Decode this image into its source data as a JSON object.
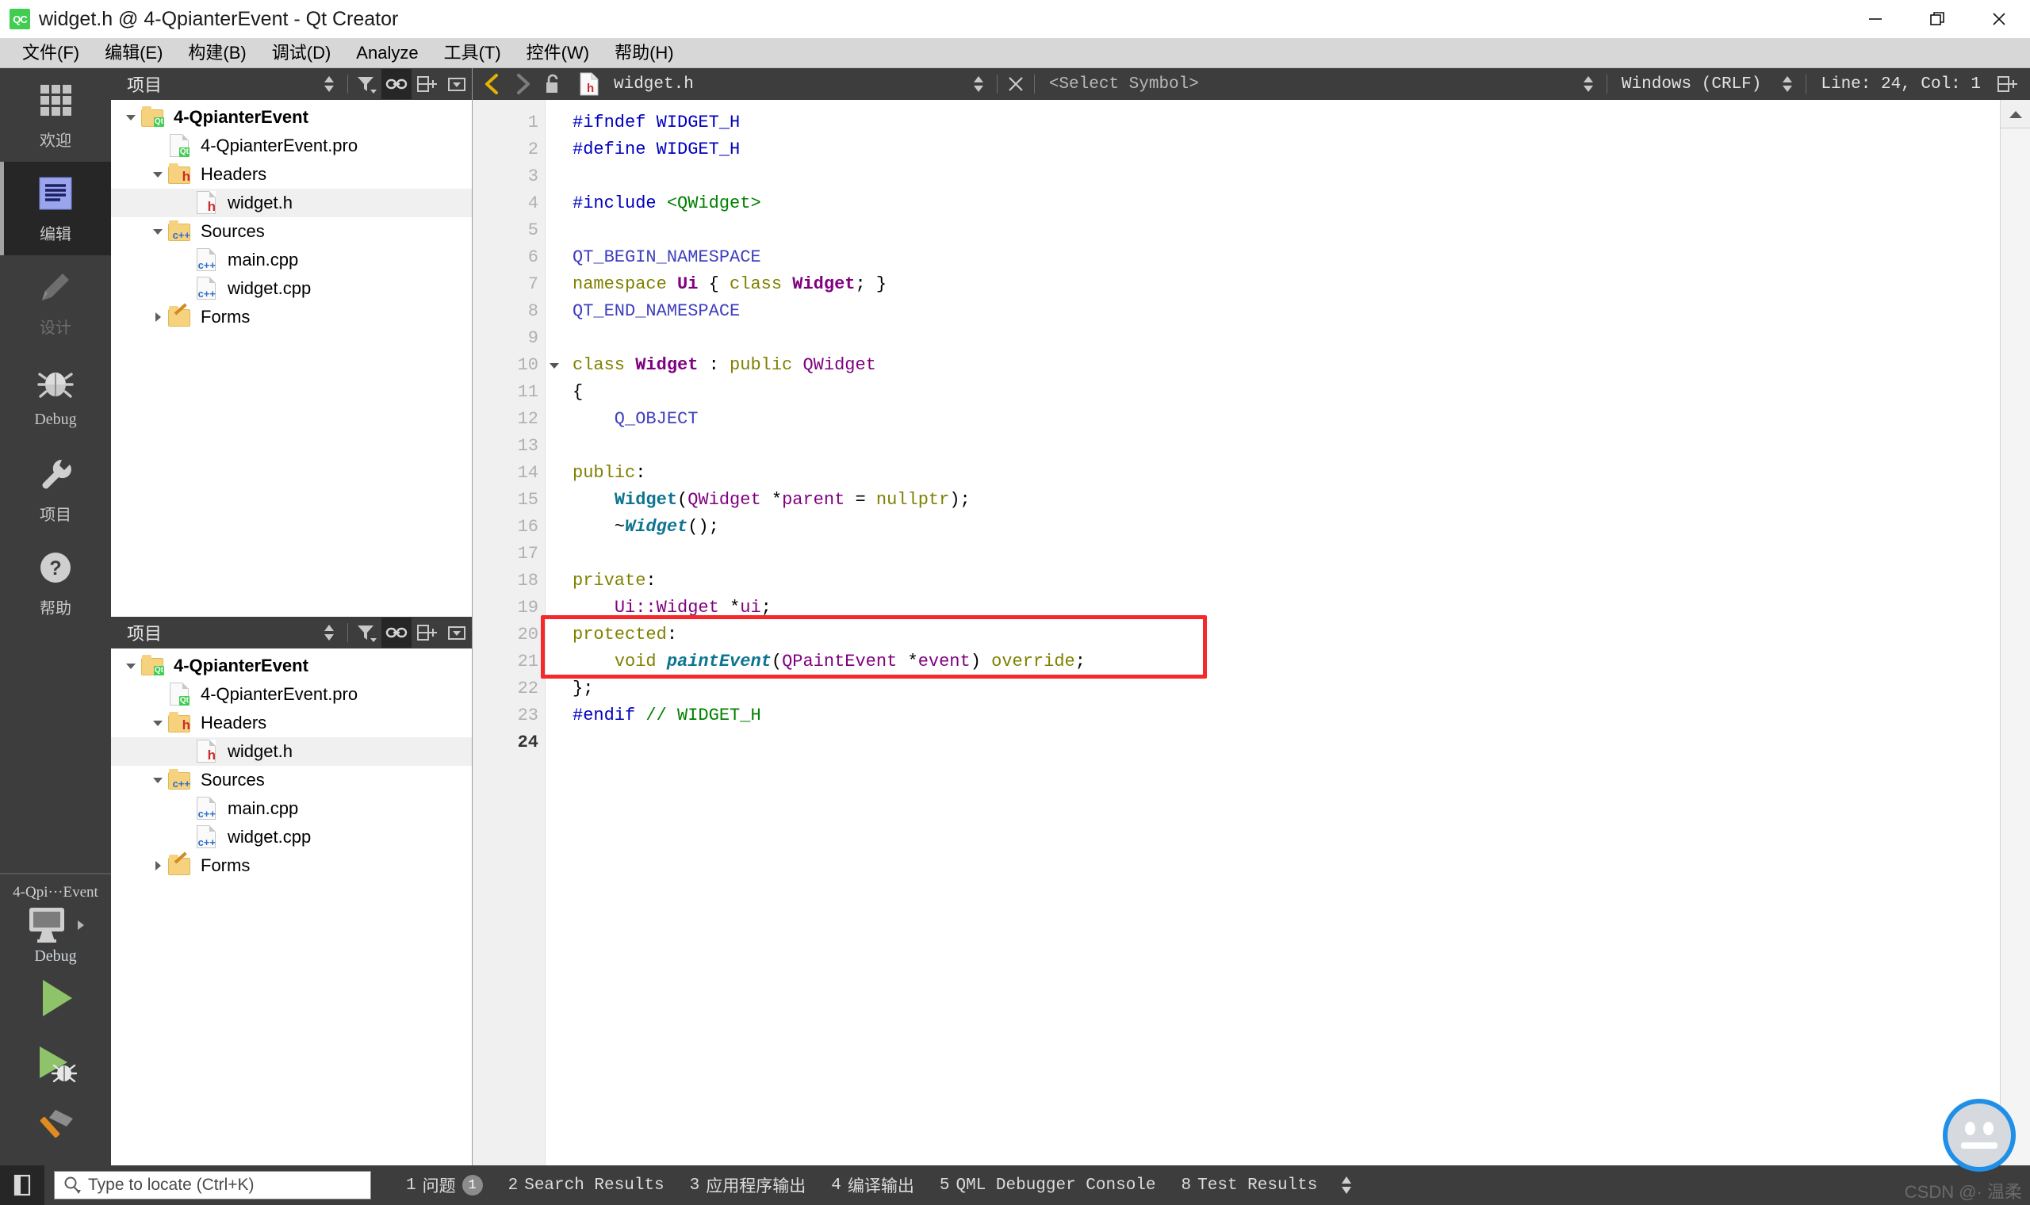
{
  "window": {
    "title": "widget.h @ 4-QpianterEvent - Qt Creator",
    "logo_text": "QC",
    "minimize": "—",
    "maximize": "❐",
    "close": "✕"
  },
  "menubar": {
    "items": [
      {
        "label": "文件(F)",
        "mnemonic": "F"
      },
      {
        "label": "编辑(E)",
        "mnemonic": "E"
      },
      {
        "label": "构建(B)",
        "mnemonic": "B"
      },
      {
        "label": "调试(D)",
        "mnemonic": "D"
      },
      {
        "label": "Analyze",
        "mnemonic": "A"
      },
      {
        "label": "工具(T)",
        "mnemonic": "T"
      },
      {
        "label": "控件(W)",
        "mnemonic": "W"
      },
      {
        "label": "帮助(H)",
        "mnemonic": "H"
      }
    ]
  },
  "activity_bar": {
    "modes": [
      {
        "label": "欢迎",
        "icon": "grid-icon",
        "active": false,
        "dim": false
      },
      {
        "label": "编辑",
        "icon": "edit-lines-icon",
        "active": true,
        "dim": false
      },
      {
        "label": "设计",
        "icon": "pencil-icon",
        "active": false,
        "dim": true
      },
      {
        "label": "Debug",
        "icon": "bug-icon",
        "active": false,
        "dim": false
      },
      {
        "label": "项目",
        "icon": "wrench-icon",
        "active": false,
        "dim": false
      },
      {
        "label": "帮助",
        "icon": "question-circle-icon",
        "active": false,
        "dim": false
      }
    ],
    "kit": {
      "project_name": "4-Qpi···Event",
      "build_config": "Debug",
      "target_icon": "desktop-icon",
      "run_label": "run-button",
      "debug_label": "run-debug-button",
      "build_label": "build-hammer-button"
    }
  },
  "project_panel_top": {
    "title": "项目",
    "tools": [
      "sort-icon",
      "filter-icon",
      "link-icon",
      "split-add-icon",
      "close-split-icon"
    ],
    "link_active": true,
    "tree": [
      {
        "label": "4-QpianterEvent",
        "icon": "qt-folder-icon",
        "indent": 0,
        "twisty": "down",
        "bold": true,
        "selected": false
      },
      {
        "label": "4-QpianterEvent.pro",
        "icon": "qt-file-icon",
        "indent": 1,
        "twisty": "none",
        "bold": false,
        "selected": false
      },
      {
        "label": "Headers",
        "icon": "h-folder-icon",
        "indent": 1,
        "twisty": "down",
        "bold": false,
        "selected": false
      },
      {
        "label": "widget.h",
        "icon": "h-file-icon",
        "indent": 2,
        "twisty": "none",
        "bold": false,
        "selected": true
      },
      {
        "label": "Sources",
        "icon": "cpp-folder-icon",
        "indent": 1,
        "twisty": "down",
        "bold": false,
        "selected": false
      },
      {
        "label": "main.cpp",
        "icon": "cpp-file-icon",
        "indent": 2,
        "twisty": "none",
        "bold": false,
        "selected": false
      },
      {
        "label": "widget.cpp",
        "icon": "cpp-file-icon",
        "indent": 2,
        "twisty": "none",
        "bold": false,
        "selected": false
      },
      {
        "label": "Forms",
        "icon": "forms-folder-icon",
        "indent": 1,
        "twisty": "right",
        "bold": false,
        "selected": false
      }
    ]
  },
  "project_panel_bottom": {
    "title": "项目",
    "tools": [
      "sort-icon",
      "filter-icon",
      "link-icon",
      "split-add-icon",
      "close-split-icon"
    ],
    "link_active": true,
    "tree": [
      {
        "label": "4-QpianterEvent",
        "icon": "qt-folder-icon",
        "indent": 0,
        "twisty": "down",
        "bold": true,
        "selected": false
      },
      {
        "label": "4-QpianterEvent.pro",
        "icon": "qt-file-icon",
        "indent": 1,
        "twisty": "none",
        "bold": false,
        "selected": false
      },
      {
        "label": "Headers",
        "icon": "h-folder-icon",
        "indent": 1,
        "twisty": "down",
        "bold": false,
        "selected": false
      },
      {
        "label": "widget.h",
        "icon": "h-file-icon",
        "indent": 2,
        "twisty": "none",
        "bold": false,
        "selected": true
      },
      {
        "label": "Sources",
        "icon": "cpp-folder-icon",
        "indent": 1,
        "twisty": "down",
        "bold": false,
        "selected": false
      },
      {
        "label": "main.cpp",
        "icon": "cpp-file-icon",
        "indent": 2,
        "twisty": "none",
        "bold": false,
        "selected": false
      },
      {
        "label": "widget.cpp",
        "icon": "cpp-file-icon",
        "indent": 2,
        "twisty": "none",
        "bold": false,
        "selected": false
      },
      {
        "label": "Forms",
        "icon": "forms-folder-icon",
        "indent": 1,
        "twisty": "right",
        "bold": false,
        "selected": false
      }
    ]
  },
  "editor_toolbar": {
    "back_icon": "chevron-left-icon",
    "forward_icon": "chevron-right-icon",
    "lock_icon": "unlocked-icon",
    "file_icon": "h-file-icon",
    "file_name": "widget.h",
    "close_icon": "close-icon",
    "symbol_selector": "<Select Symbol>",
    "line_ending": "Windows (CRLF)",
    "cursor_position": "Line: 24, Col: 1",
    "split_icon": "split-add-icon"
  },
  "editor": {
    "gutter_current_line": 24,
    "total_lines": 24,
    "fold_marker_line": 10,
    "lines": [
      {
        "n": 1,
        "tokens": [
          {
            "t": "#ifndef WIDGET_H",
            "c": "k-pre"
          }
        ]
      },
      {
        "n": 2,
        "tokens": [
          {
            "t": "#define WIDGET_H",
            "c": "k-pre"
          }
        ]
      },
      {
        "n": 3,
        "tokens": []
      },
      {
        "n": 4,
        "tokens": [
          {
            "t": "#include ",
            "c": "k-pre"
          },
          {
            "t": "<QWidget>",
            "c": "k-str"
          }
        ]
      },
      {
        "n": 5,
        "tokens": []
      },
      {
        "n": 6,
        "tokens": [
          {
            "t": "QT_BEGIN_NAMESPACE",
            "c": "k-macro"
          }
        ]
      },
      {
        "n": 7,
        "tokens": [
          {
            "t": "namespace ",
            "c": "k-key"
          },
          {
            "t": "Ui",
            "c": "k-typeb"
          },
          {
            "t": " { ",
            "c": "k-plain"
          },
          {
            "t": "class ",
            "c": "k-key"
          },
          {
            "t": "Widget",
            "c": "k-typeb"
          },
          {
            "t": "; }",
            "c": "k-plain"
          }
        ]
      },
      {
        "n": 8,
        "tokens": [
          {
            "t": "QT_END_NAMESPACE",
            "c": "k-macro"
          }
        ]
      },
      {
        "n": 9,
        "tokens": []
      },
      {
        "n": 10,
        "tokens": [
          {
            "t": "class ",
            "c": "k-key"
          },
          {
            "t": "Widget",
            "c": "k-typeb"
          },
          {
            "t": " : ",
            "c": "k-plain"
          },
          {
            "t": "public ",
            "c": "k-key"
          },
          {
            "t": "QWidget",
            "c": "k-type"
          }
        ]
      },
      {
        "n": 11,
        "tokens": [
          {
            "t": "{",
            "c": "k-plain"
          }
        ]
      },
      {
        "n": 12,
        "tokens": [
          {
            "t": "    Q_OBJECT",
            "c": "k-macro"
          }
        ]
      },
      {
        "n": 13,
        "tokens": []
      },
      {
        "n": 14,
        "tokens": [
          {
            "t": "public",
            "c": "k-key"
          },
          {
            "t": ":",
            "c": "k-plain"
          }
        ]
      },
      {
        "n": 15,
        "tokens": [
          {
            "t": "    ",
            "c": "k-plain"
          },
          {
            "t": "Widget",
            "c": "k-fn"
          },
          {
            "t": "(",
            "c": "k-plain"
          },
          {
            "t": "QWidget",
            "c": "k-type"
          },
          {
            "t": " *",
            "c": "k-plain"
          },
          {
            "t": "parent",
            "c": "k-type"
          },
          {
            "t": " = ",
            "c": "k-plain"
          },
          {
            "t": "nullptr",
            "c": "k-key"
          },
          {
            "t": ");",
            "c": "k-plain"
          }
        ]
      },
      {
        "n": 16,
        "tokens": [
          {
            "t": "    ~",
            "c": "k-plain"
          },
          {
            "t": "Widget",
            "c": "k-fni"
          },
          {
            "t": "();",
            "c": "k-plain"
          }
        ]
      },
      {
        "n": 17,
        "tokens": []
      },
      {
        "n": 18,
        "tokens": [
          {
            "t": "private",
            "c": "k-key"
          },
          {
            "t": ":",
            "c": "k-plain"
          }
        ]
      },
      {
        "n": 19,
        "tokens": [
          {
            "t": "    ",
            "c": "k-plain"
          },
          {
            "t": "Ui::Widget",
            "c": "k-type"
          },
          {
            "t": " *",
            "c": "k-plain"
          },
          {
            "t": "ui",
            "c": "k-type"
          },
          {
            "t": ";",
            "c": "k-plain"
          }
        ]
      },
      {
        "n": 20,
        "tokens": [
          {
            "t": "protected",
            "c": "k-key"
          },
          {
            "t": ":",
            "c": "k-plain"
          }
        ]
      },
      {
        "n": 21,
        "tokens": [
          {
            "t": "    ",
            "c": "k-plain"
          },
          {
            "t": "void ",
            "c": "k-key"
          },
          {
            "t": "paintEvent",
            "c": "k-fni"
          },
          {
            "t": "(",
            "c": "k-plain"
          },
          {
            "t": "QPaintEvent",
            "c": "k-type"
          },
          {
            "t": " *",
            "c": "k-plain"
          },
          {
            "t": "event",
            "c": "k-type"
          },
          {
            "t": ") ",
            "c": "k-plain"
          },
          {
            "t": "override",
            "c": "k-key"
          },
          {
            "t": ";",
            "c": "k-plain"
          }
        ]
      },
      {
        "n": 22,
        "tokens": [
          {
            "t": "};",
            "c": "k-plain"
          }
        ]
      },
      {
        "n": 23,
        "tokens": [
          {
            "t": "#endif ",
            "c": "k-pre"
          },
          {
            "t": "// WIDGET_H",
            "c": "k-cmt"
          }
        ]
      },
      {
        "n": 24,
        "tokens": []
      }
    ],
    "annotation": {
      "type": "red-rectangle",
      "color": "#f5292c",
      "covers_lines": "20-21",
      "note": "highlights protected: void paintEvent(QPaintEvent *event) override;"
    }
  },
  "statusbar": {
    "sidebar_toggle_icon": "toggle-sidebar-icon",
    "locator_placeholder": "Type to locate (Ctrl+K)",
    "locator_icon": "search-icon",
    "output_tabs": [
      {
        "num": "1",
        "label": "问题",
        "badge": "1"
      },
      {
        "num": "2",
        "label": "Search Results",
        "badge": ""
      },
      {
        "num": "3",
        "label": "应用程序输出",
        "badge": ""
      },
      {
        "num": "4",
        "label": "编译输出",
        "badge": ""
      },
      {
        "num": "5",
        "label": "QML Debugger Console",
        "badge": ""
      },
      {
        "num": "8",
        "label": "Test Results",
        "badge": ""
      }
    ],
    "spinner_icon": "updown-arrows-icon"
  },
  "watermark": {
    "text": "CSDN @· 温柔",
    "avatar_icon": "chat-avatar-icon"
  },
  "colors": {
    "accent_qt_green": "#41cd52",
    "dark_chrome": "#3d3d3d",
    "dark_chrome_active": "#262626",
    "annotation_red": "#f5292c",
    "run_green": "#8ec36a",
    "hammer_orange": "#e08b1e"
  }
}
